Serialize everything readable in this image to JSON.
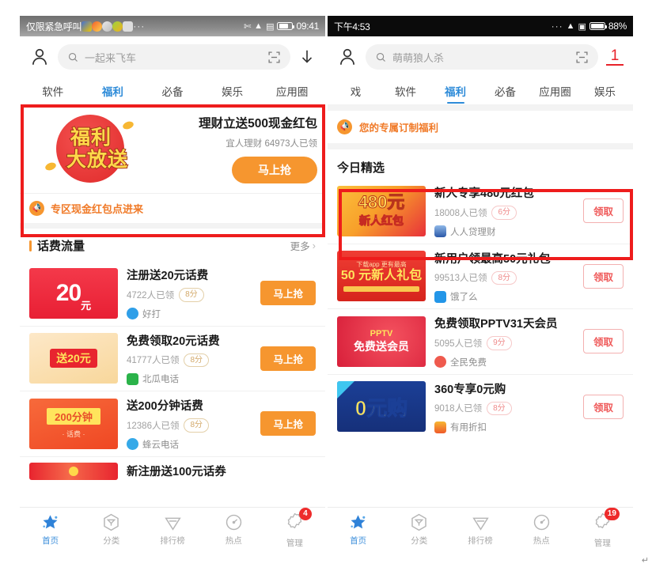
{
  "left_phone": {
    "status_bar": {
      "carrier": "仅限紧急呼叫",
      "time": "09:41",
      "dots": "···"
    },
    "search": {
      "placeholder": "一起来飞车"
    },
    "tabs": [
      {
        "label": "软件",
        "active": false
      },
      {
        "label": "福利",
        "active": true
      },
      {
        "label": "必备",
        "active": false
      },
      {
        "label": "娱乐",
        "active": false
      },
      {
        "label": "应用圈",
        "active": false
      }
    ],
    "banner": {
      "art_line1": "福利",
      "art_line2": "大放送",
      "title": "理财立送500现金红包",
      "subtitle": "宜人理财 64973人已领",
      "button": "马上抢",
      "footer": "专区现金红包点进来"
    },
    "section": {
      "title": "话费流量",
      "more": "更多"
    },
    "items": [
      {
        "title": "注册送20元话费",
        "count": "4722人已领",
        "score": "8分",
        "brand": "好打",
        "button": "马上抢",
        "thumb_big": "20",
        "thumb_small": "元"
      },
      {
        "title": "免费领取20元话费",
        "count": "41777人已领",
        "score": "8分",
        "brand": "北瓜电话",
        "button": "马上抢",
        "thumb_tag": "送20元"
      },
      {
        "title": "送200分钟话费",
        "count": "12386人已领",
        "score": "8分",
        "brand": "蜂云电话",
        "button": "马上抢",
        "thumb_band": "200分钟",
        "thumb_sub": "· 话费 ·"
      },
      {
        "title": "新注册送100元话券",
        "count": "",
        "score": "",
        "brand": "",
        "button": ""
      }
    ],
    "nav": [
      {
        "label": "首页",
        "icon": "star-icon",
        "active": true,
        "badge": ""
      },
      {
        "label": "分类",
        "icon": "category-icon",
        "active": false,
        "badge": ""
      },
      {
        "label": "排行榜",
        "icon": "ranking-icon",
        "active": false,
        "badge": ""
      },
      {
        "label": "热点",
        "icon": "hotspot-icon",
        "active": false,
        "badge": ""
      },
      {
        "label": "管理",
        "icon": "manage-icon",
        "active": false,
        "badge": "4"
      }
    ]
  },
  "right_phone": {
    "status_bar": {
      "time": "下午4:53",
      "battery": "88%",
      "dots": "···"
    },
    "search": {
      "placeholder": "萌萌狼人杀",
      "download_count": "1"
    },
    "tabs": [
      {
        "label": "戏",
        "active": false
      },
      {
        "label": "软件",
        "active": false
      },
      {
        "label": "福利",
        "active": true
      },
      {
        "label": "必备",
        "active": false
      },
      {
        "label": "应用圈",
        "active": false
      },
      {
        "label": "娱乐",
        "active": false
      }
    ],
    "custom_banner": {
      "text": "您的专属订制福利"
    },
    "section": {
      "title": "今日精选"
    },
    "items": [
      {
        "title": "新人专享480元红包",
        "count": "18008人已领",
        "score": "6分",
        "brand": "人人贷理财",
        "button": "领取",
        "thumb_num": "480元",
        "thumb_text": "新人红包"
      },
      {
        "title": "新用户领最高50元礼包",
        "count": "99513人已领",
        "score": "8分",
        "brand": "饿了么",
        "button": "领取",
        "thumb_l1": "下载app 更有最高",
        "thumb_l2": "50 元新人礼包"
      },
      {
        "title": "免费领取PPTV31天会员",
        "count": "5095人已领",
        "score": "9分",
        "brand": "全民免费",
        "button": "领取",
        "thumb_l1": "PPTV",
        "thumb_l2": "免费送会员"
      },
      {
        "title": "360专享0元购",
        "count": "9018人已领",
        "score": "8分",
        "brand": "有用折扣",
        "button": "领取",
        "thumb_big": "0元购"
      }
    ],
    "nav": [
      {
        "label": "首页",
        "icon": "star-icon",
        "active": true,
        "badge": ""
      },
      {
        "label": "分类",
        "icon": "category-icon",
        "active": false,
        "badge": ""
      },
      {
        "label": "排行榜",
        "icon": "ranking-icon",
        "active": false,
        "badge": ""
      },
      {
        "label": "热点",
        "icon": "hotspot-icon",
        "active": false,
        "badge": ""
      },
      {
        "label": "管理",
        "icon": "manage-icon",
        "active": false,
        "badge": "19"
      }
    ]
  },
  "annotations": {
    "highlight_color": "#ee1c1c"
  },
  "corner_mark": "↵"
}
